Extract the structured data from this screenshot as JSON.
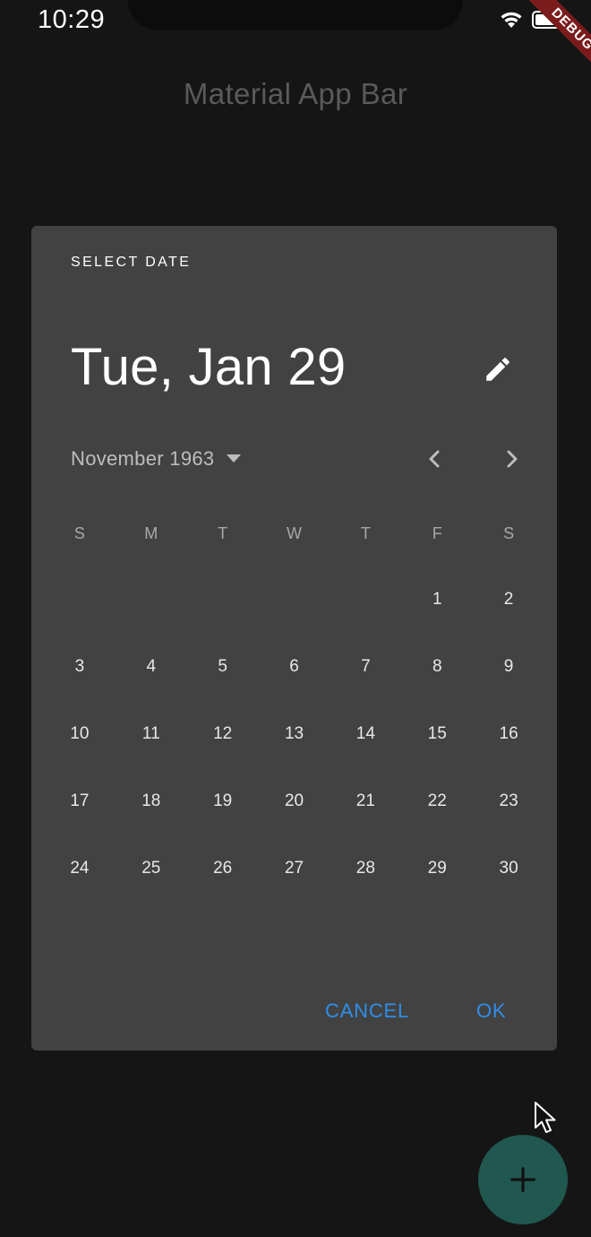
{
  "status_bar": {
    "time": "10:29",
    "debug_label": "DEBUG"
  },
  "app_bar": {
    "title": "Material App Bar"
  },
  "dialog": {
    "header_label": "SELECT DATE",
    "selected_date": "Tue, Jan 29",
    "month_year": "November 1963",
    "weekdays": [
      "S",
      "M",
      "T",
      "W",
      "T",
      "F",
      "S"
    ],
    "days": [
      "",
      "",
      "",
      "",
      "",
      "1",
      "2",
      "3",
      "4",
      "5",
      "6",
      "7",
      "8",
      "9",
      "10",
      "11",
      "12",
      "13",
      "14",
      "15",
      "16",
      "17",
      "18",
      "19",
      "20",
      "21",
      "22",
      "23",
      "24",
      "25",
      "26",
      "27",
      "28",
      "29",
      "30"
    ],
    "cancel_label": "CANCEL",
    "ok_label": "OK"
  },
  "icons": {
    "edit": "pencil-icon",
    "month_dropdown": "caret-down-icon",
    "prev": "chevron-left-icon",
    "next": "chevron-right-icon",
    "fab": "plus-icon"
  },
  "colors": {
    "background": "#151515",
    "dialog": "#424242",
    "accent": "#2f8ee8",
    "fab": "#20584f"
  }
}
